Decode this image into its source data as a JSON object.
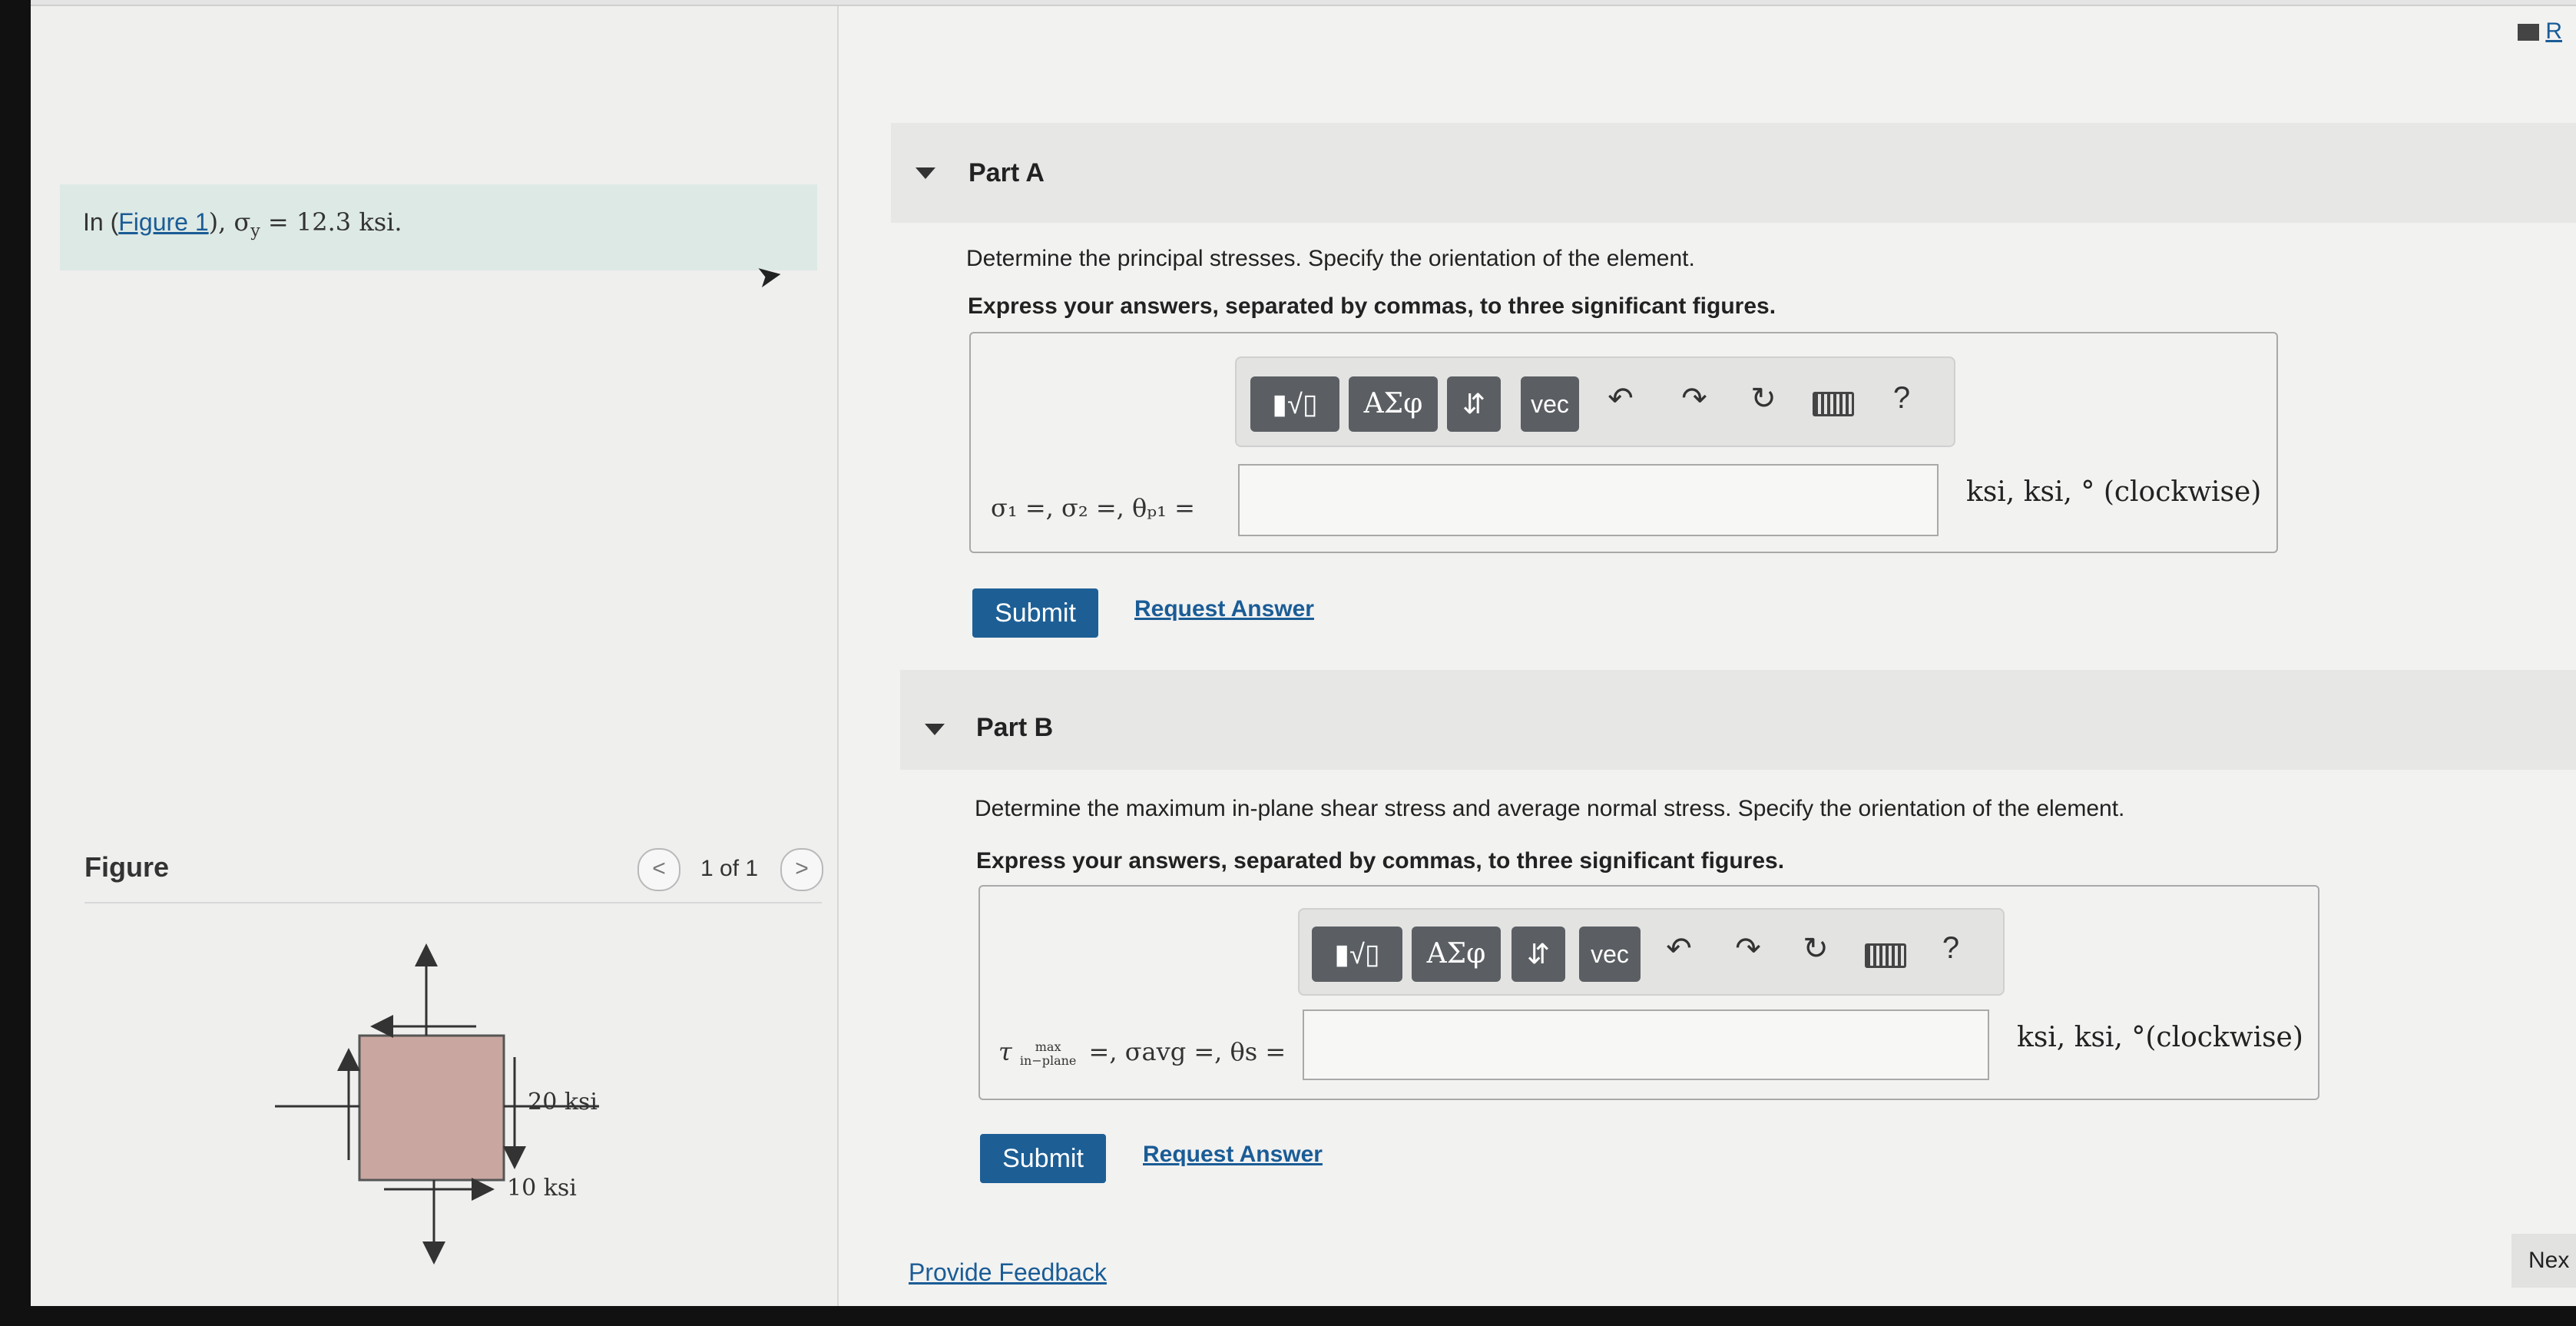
{
  "problem": {
    "prefix": "In (",
    "figure_link": "Figure 1",
    "suffix_math": "), σ",
    "sub": "y",
    "equals": " = 12.3 ksi."
  },
  "figure_panel": {
    "title": "Figure",
    "pager": "1 of 1",
    "prev_icon": "<",
    "next_icon": ">",
    "labels": {
      "right_stress": "20 ksi",
      "bottom_stress": "10 ksi"
    }
  },
  "top_right": {
    "text": "R"
  },
  "toolbar": {
    "templates_label": "▮√▯",
    "greek_label": "ΑΣφ",
    "arrows_label": "⇵",
    "vec_label": "vec",
    "undo_icon": "↶",
    "redo_icon": "↷",
    "reset_icon": "↻",
    "help_icon": "?"
  },
  "part_a": {
    "title": "Part A",
    "question": "Determine the principal stresses. Specify the orientation of the element.",
    "instruction": "Express your answers, separated by commas, to three significant figures.",
    "answer_label": "σ₁ =, σ₂ =, θₚ₁ =",
    "input_value": "",
    "units": "ksi, ksi, ° (clockwise)",
    "submit": "Submit",
    "request": "Request Answer"
  },
  "part_b": {
    "title": "Part B",
    "question": "Determine the maximum in-plane shear stress and average normal stress. Specify the orientation of the element.",
    "instruction": "Express your answers, separated by commas, to three significant figures.",
    "tau": "τ",
    "tau_sup": "max",
    "tau_sub": "in−plane",
    "answer_label_rest": "=, σavg =, θs =",
    "input_value": "",
    "units": "ksi, ksi, °(clockwise)",
    "submit": "Submit",
    "request": "Request Answer"
  },
  "footer": {
    "feedback": "Provide Feedback",
    "next": "Nex"
  },
  "colors": {
    "accent": "#1d5f95",
    "link": "#1a5c96",
    "element_fill": "#c9a7a0"
  }
}
